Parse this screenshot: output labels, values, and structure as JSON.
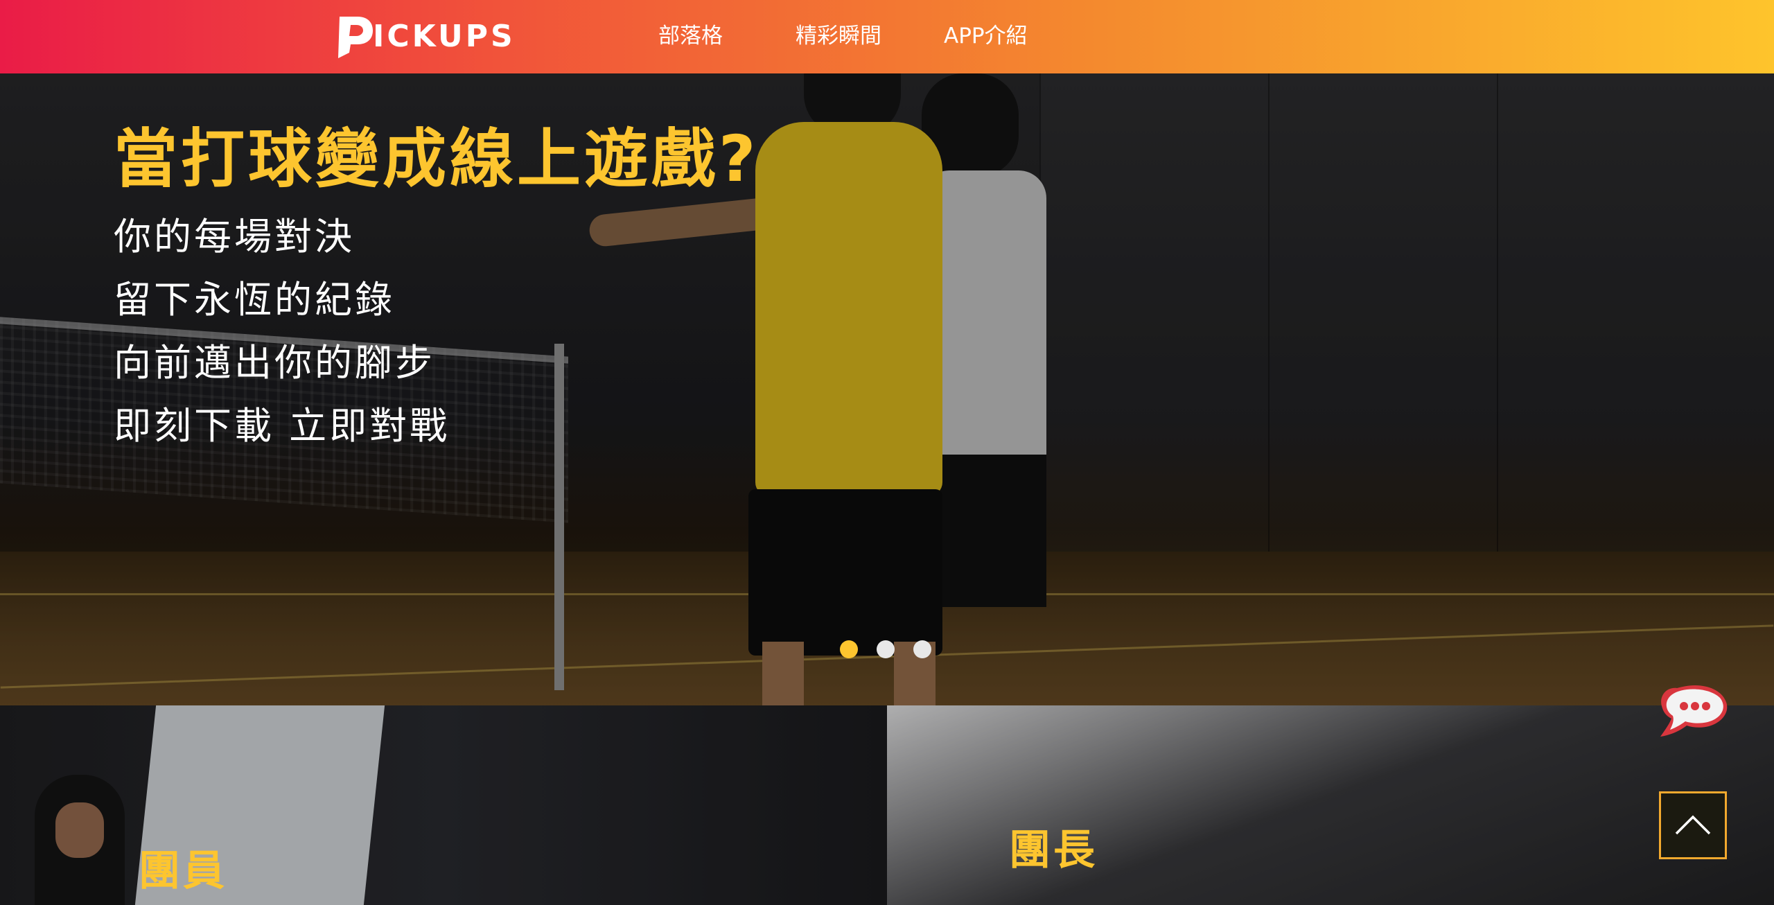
{
  "brand": {
    "logo_text": "ICKUPS",
    "logo_mark": "P"
  },
  "nav": {
    "items": [
      {
        "label": "部落格"
      },
      {
        "label": "精彩瞬間"
      },
      {
        "label": "APP介紹"
      }
    ]
  },
  "hero": {
    "title": "當打球變成線上遊戲?",
    "lines": [
      "你的每場對決",
      "留下永恆的紀錄",
      "向前邁出你的腳步",
      "即刻下載 立即對戰"
    ],
    "carousel": {
      "slide_count": 3,
      "active_index": 0
    }
  },
  "cards": {
    "member": {
      "title": "團員"
    },
    "leader": {
      "title": "團長"
    }
  },
  "floating": {
    "chat_icon": "chat-bubble-icon",
    "back_to_top_icon": "chevron-up-icon"
  },
  "colors": {
    "accent": "#fdc52f",
    "nav_gradient_start": "#ea1c47",
    "nav_gradient_end": "#fec42c",
    "back_to_top_border": "#f2a92e",
    "chat_red": "#d9363e"
  }
}
